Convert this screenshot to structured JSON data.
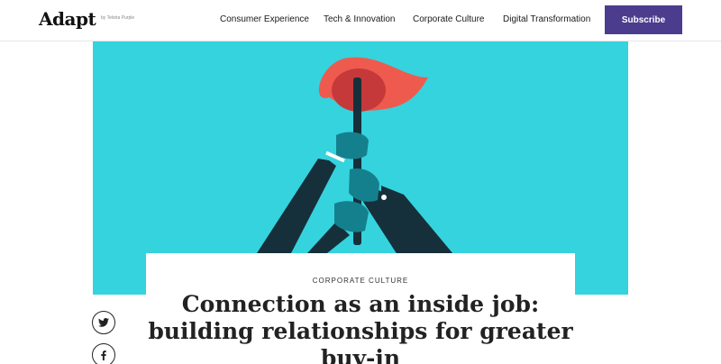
{
  "brand": {
    "logo": "Adapt",
    "tagline": "by Telstra Purple"
  },
  "nav": {
    "items": [
      {
        "label": "Consumer Experience"
      },
      {
        "label": "Tech & Innovation"
      },
      {
        "label": "Corporate Culture"
      },
      {
        "label": "Digital Transformation"
      }
    ],
    "subscribe_label": "Subscribe"
  },
  "hero": {
    "illustration": "hands-holding-torch",
    "colors": {
      "background": "#35d3de",
      "flame": "#ef5a4e",
      "sleeve": "#16303b",
      "hand": "#15808d"
    }
  },
  "article": {
    "category": "CORPORATE CULTURE",
    "title": "Connection as an inside job: building relationships for greater buy-in"
  },
  "share": [
    {
      "icon": "twitter-icon"
    },
    {
      "icon": "facebook-icon"
    }
  ]
}
